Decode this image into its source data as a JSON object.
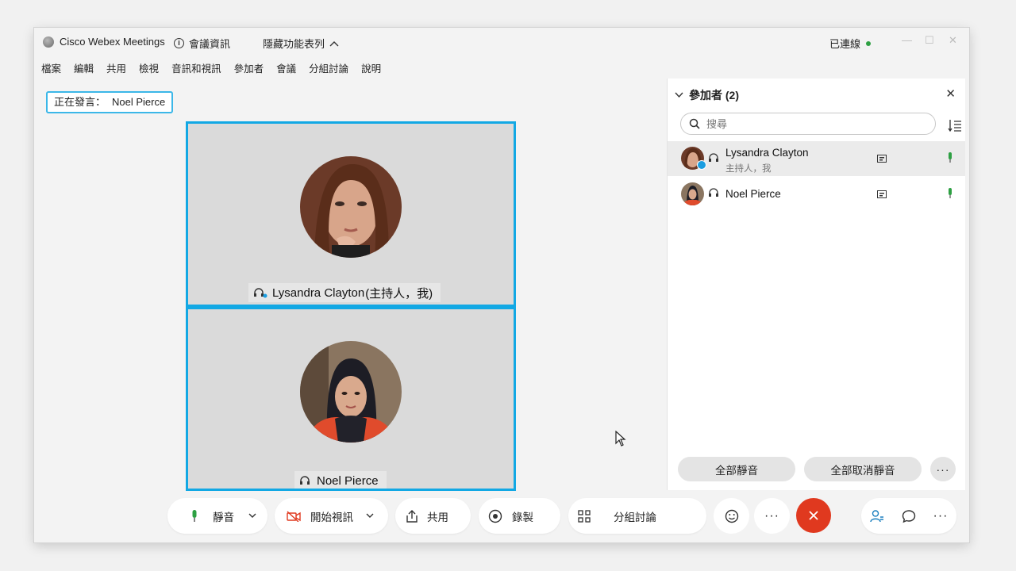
{
  "titlebar": {
    "app_title": "Cisco Webex Meetings",
    "meeting_info": "會議資訊",
    "hide_menu": "隱藏功能表列",
    "connection_status": "已連線",
    "connection_color": "#2ea043"
  },
  "menu": [
    "檔案",
    "編輯",
    "共用",
    "檢視",
    "音訊和視訊",
    "參加者",
    "會議",
    "分組討論",
    "說明"
  ],
  "stage": {
    "speaking_label": "正在發言：",
    "speaking_name": "Noel Pierce",
    "tiles": [
      {
        "name": "Lysandra Clayton",
        "suffix": "(主持人，我)",
        "icon": "headset-icon"
      },
      {
        "name": "Noel Pierce",
        "suffix": "",
        "icon": "headset-icon"
      }
    ],
    "active_border_color": "#12a8e4"
  },
  "participants": {
    "title": "參加者 (2)",
    "search_placeholder": "搜尋",
    "list": [
      {
        "name": "Lysandra Clayton",
        "role": "主持人，我",
        "selected": true
      },
      {
        "name": "Noel Pierce",
        "role": "",
        "selected": false
      }
    ],
    "mute_all": "全部靜音",
    "unmute_all": "全部取消靜音"
  },
  "toolbar": {
    "mute": "靜音",
    "start_video": "開始視訊",
    "share": "共用",
    "record": "錄製",
    "breakout": "分組討論",
    "end_color": "#e0391f"
  }
}
